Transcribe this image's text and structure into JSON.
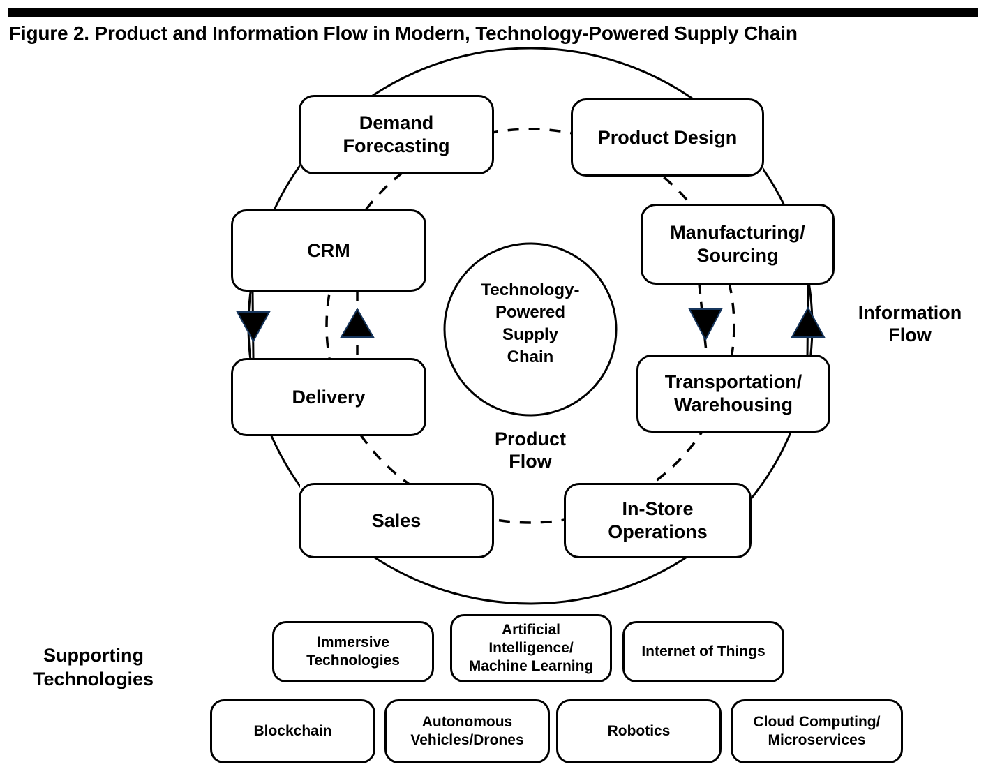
{
  "figure": {
    "title": "Figure 2. Product and Information Flow in Modern, Technology-Powered Supply Chain"
  },
  "center": {
    "circle_label_lines": [
      "Technology-",
      "Powered",
      "Supply",
      "Chain"
    ],
    "circle_label": "Technology-Powered Supply Chain"
  },
  "flow_labels": {
    "product_flow": "Product\nFlow",
    "product_flow_line1": "Product",
    "product_flow_line2": "Flow",
    "information_flow": "Information\nFlow",
    "information_flow_line1": "Information",
    "information_flow_line2": "Flow"
  },
  "cycle_nodes": [
    {
      "id": "demand-forecasting",
      "label": "Demand\nForecasting",
      "line1": "Demand",
      "line2": "Forecasting"
    },
    {
      "id": "product-design",
      "label": "Product Design",
      "line1": "Product Design",
      "line2": ""
    },
    {
      "id": "crm",
      "label": "CRM",
      "line1": "CRM",
      "line2": ""
    },
    {
      "id": "manufacturing-sourcing",
      "label": "Manufacturing/\nSourcing",
      "line1": "Manufacturing/",
      "line2": "Sourcing"
    },
    {
      "id": "delivery",
      "label": "Delivery",
      "line1": "Delivery",
      "line2": ""
    },
    {
      "id": "transportation-warehousing",
      "label": "Transportation/\nWarehousing",
      "line1": "Transportation/",
      "line2": "Warehousing"
    },
    {
      "id": "sales",
      "label": "Sales",
      "line1": "Sales",
      "line2": ""
    },
    {
      "id": "in-store-operations",
      "label": "In-Store\nOperations",
      "line1": "In-Store",
      "line2": "Operations"
    }
  ],
  "supporting": {
    "section_label": "Supporting\nTechnologies",
    "section_label_line1": "Supporting",
    "section_label_line2": "Technologies",
    "row1": [
      {
        "id": "immersive-technologies",
        "label": "Immersive\nTechnologies",
        "line1": "Immersive",
        "line2": "Technologies",
        "line3": ""
      },
      {
        "id": "artificial-intelligence-machine-learning",
        "label": "Artificial Intelligence/ Machine Learning",
        "line1": "Artificial",
        "line2": "Intelligence/",
        "line3": "Machine Learning"
      },
      {
        "id": "internet-of-things",
        "label": "Internet of Things",
        "line1": "Internet of Things",
        "line2": "",
        "line3": ""
      }
    ],
    "row2": [
      {
        "id": "blockchain",
        "label": "Blockchain",
        "line1": "Blockchain",
        "line2": ""
      },
      {
        "id": "autonomous-vehicles-drones",
        "label": "Autonomous\nVehicles/Drones",
        "line1": "Autonomous",
        "line2": "Vehicles/Drones"
      },
      {
        "id": "robotics",
        "label": "Robotics",
        "line1": "Robotics",
        "line2": ""
      },
      {
        "id": "cloud-computing-microservices",
        "label": "Cloud Computing/\nMicroservices",
        "line1": "Cloud Computing/",
        "line2": "Microservices"
      }
    ]
  },
  "colors": {
    "stroke": "#000000",
    "fill": "#ffffff",
    "arrow": "#000000",
    "title": "#000000"
  },
  "legend": {
    "solid_line_meaning": "Product Flow",
    "dashed_line_meaning": "Information Flow"
  }
}
